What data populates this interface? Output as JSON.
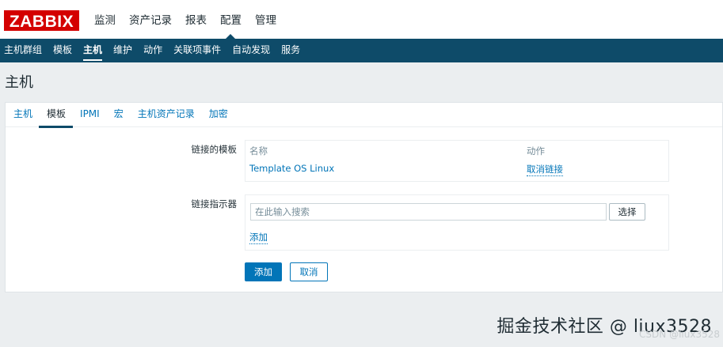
{
  "brand": {
    "logo_text": "ZABBIX"
  },
  "main_menu": [
    {
      "label": "监测"
    },
    {
      "label": "资产记录"
    },
    {
      "label": "报表"
    },
    {
      "label": "配置"
    },
    {
      "label": "管理"
    }
  ],
  "sub_menu": [
    {
      "label": "主机群组"
    },
    {
      "label": "模板"
    },
    {
      "label": "主机"
    },
    {
      "label": "维护"
    },
    {
      "label": "动作"
    },
    {
      "label": "关联项事件"
    },
    {
      "label": "自动发现"
    },
    {
      "label": "服务"
    }
  ],
  "page": {
    "title": "主机"
  },
  "tabs": [
    {
      "label": "主机"
    },
    {
      "label": "模板"
    },
    {
      "label": "IPMI"
    },
    {
      "label": "宏"
    },
    {
      "label": "主机资产记录"
    },
    {
      "label": "加密"
    }
  ],
  "form": {
    "linked_templates_label": "链接的模板",
    "linked_table": {
      "col_name": "名称",
      "col_action": "动作",
      "rows": [
        {
          "name": "Template OS Linux",
          "action": "取消链接"
        }
      ]
    },
    "link_indicator_label": "链接指示器",
    "search": {
      "placeholder": "在此输入搜索"
    },
    "select_button": "选择",
    "add_link": "添加",
    "add_button": "添加",
    "cancel_button": "取消"
  },
  "watermark": {
    "main": "掘金技术社区 @ liux3528",
    "sub": "CSDN @liux3528"
  }
}
